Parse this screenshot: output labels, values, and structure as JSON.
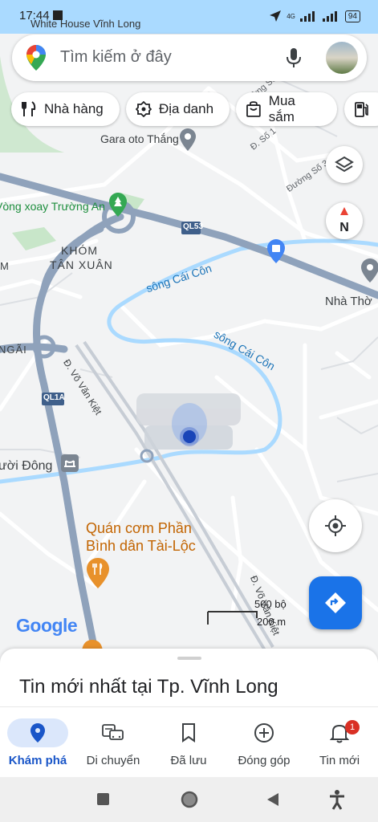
{
  "status_bar": {
    "time": "17:44",
    "network": "4G",
    "battery": "94"
  },
  "search": {
    "placeholder": "Tìm kiếm ở đây",
    "top_partial_label": "White House Vĩnh Long"
  },
  "chips": [
    {
      "label": "Nhà hàng",
      "icon": "fork-knife-icon"
    },
    {
      "label": "Địa danh",
      "icon": "landmark-icon"
    },
    {
      "label": "Mua sắm",
      "icon": "shopping-bag-icon"
    },
    {
      "label": "",
      "icon": "gas-station-icon"
    }
  ],
  "map": {
    "labels": {
      "gara": "Gara oto Thắng",
      "vong_xoay": "Vòng xoay Trường An",
      "khom": "KHÓM",
      "tan_xuan": "TÂN XUÂN",
      "ql53": "QL53",
      "song_cai_con_1": "sông Cái Côn",
      "song_cai_con_2": "sông Cái Côn",
      "nha_tho": "Nhà Thờ",
      "ngai": "NGÃI",
      "vo_van_kiet_1": "Đ. Võ Văn Kiệt",
      "vo_van_kiet_2": "Đ. Võ Văn Kiệt",
      "ql1a": "QL1A",
      "nuoi_dong": "ười Đông",
      "quan_com_1": "Quán cơm Phần",
      "quan_com_2": "Bình dân Tài-Lộc",
      "duong_so_3": "Đường Số 3",
      "duong_so_2": "Đường Số 2",
      "duong_so_1": "Đ. Số 1",
      "truong": "Đ. Trườ",
      "m": "M"
    },
    "scale": {
      "top": "500 bộ",
      "bottom": "200 m"
    },
    "google_logo": "Google"
  },
  "sheet": {
    "title": "Tin mới nhất tại Tp. Vĩnh Long"
  },
  "nav": [
    {
      "label": "Khám phá",
      "icon": "explore-pin-icon",
      "active": true
    },
    {
      "label": "Di chuyển",
      "icon": "commute-icon",
      "active": false
    },
    {
      "label": "Đã lưu",
      "icon": "bookmark-icon",
      "active": false
    },
    {
      "label": "Đóng góp",
      "icon": "add-circle-icon",
      "active": false
    },
    {
      "label": "Tin mới",
      "icon": "bell-icon",
      "active": false,
      "badge": "1"
    }
  ],
  "colors": {
    "accent": "#1a73e8",
    "road_major": "#8fa2bb",
    "road_minor": "#ffffff",
    "water": "#aadaff",
    "park": "#c8e6c9",
    "pin_orange": "#e8912b"
  }
}
